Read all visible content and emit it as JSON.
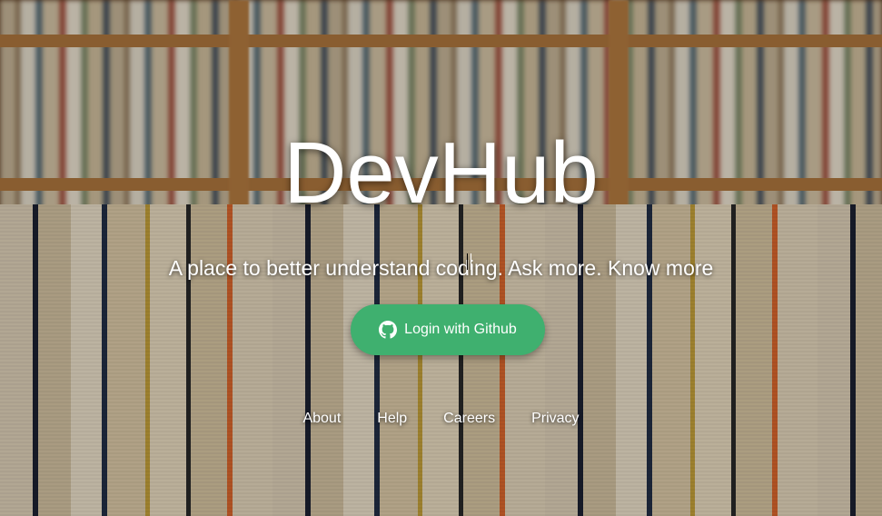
{
  "hero": {
    "title": "DevHub",
    "subtitle": "A place to better understand coding. Ask more. Know more"
  },
  "login": {
    "label": "Login with Github",
    "icon": "github-icon",
    "color": "#3fb06f"
  },
  "footer": {
    "links": [
      "About",
      "Help",
      "Careers",
      "Privacy"
    ]
  }
}
